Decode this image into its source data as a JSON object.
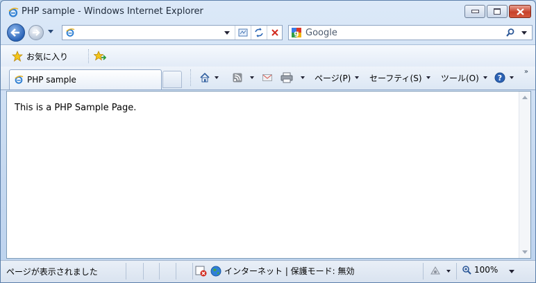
{
  "window": {
    "title": "PHP sample - Windows Internet Explorer"
  },
  "address_bar": {
    "url": ""
  },
  "search": {
    "provider": "Google"
  },
  "favorites_bar": {
    "favorites_label": "お気に入り"
  },
  "tabs": [
    {
      "label": "PHP sample"
    }
  ],
  "command_bar": {
    "page_label": "ページ(P)",
    "safety_label": "セーフティ(S)",
    "tools_label": "ツール(O)",
    "more": "»"
  },
  "content": {
    "text": "This is a PHP Sample Page."
  },
  "status_bar": {
    "status_text": "ページが表示されました",
    "zone_text": "インターネット | 保護モード: 無効",
    "zoom": "100%"
  },
  "colors": {
    "accent": "#2a64b8",
    "close": "#c7422b"
  },
  "icons": [
    "ie-icon",
    "back-arrow-icon",
    "forward-arrow-icon",
    "compatibility-icon",
    "refresh-icon",
    "stop-icon",
    "google-icon",
    "search-icon",
    "favorites-star-icon",
    "add-favorite-icon",
    "home-icon",
    "feeds-icon",
    "mail-icon",
    "print-icon",
    "help-icon",
    "globe-icon",
    "popup-blocked-icon",
    "magnifier-icon"
  ]
}
